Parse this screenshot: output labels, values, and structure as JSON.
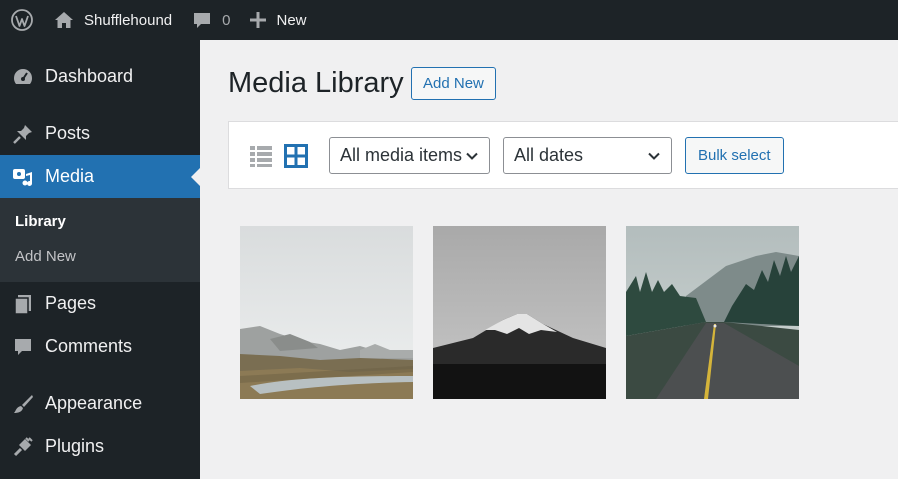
{
  "adminbar": {
    "site_name": "Shufflehound",
    "comments_count": "0",
    "new_label": "New"
  },
  "sidebar": {
    "items": [
      {
        "label": "Dashboard",
        "icon": "dashboard-icon"
      },
      {
        "label": "Posts",
        "icon": "pin-icon"
      },
      {
        "label": "Media",
        "icon": "media-icon"
      },
      {
        "label": "Pages",
        "icon": "pages-icon"
      },
      {
        "label": "Comments",
        "icon": "comment-icon"
      },
      {
        "label": "Appearance",
        "icon": "brush-icon"
      },
      {
        "label": "Plugins",
        "icon": "plug-icon"
      }
    ],
    "submenu": [
      {
        "label": "Library"
      },
      {
        "label": "Add New"
      }
    ]
  },
  "main": {
    "title": "Media Library",
    "add_new_label": "Add New",
    "filter_type": "All media items",
    "filter_date": "All dates",
    "bulk_select_label": "Bulk select",
    "thumbnails": [
      {
        "subject": "misty-hills-river",
        "icon": "image"
      },
      {
        "subject": "mountain-peak",
        "icon": "image"
      },
      {
        "subject": "forest-road",
        "icon": "image"
      }
    ]
  },
  "colors": {
    "admin_dark": "#1d2327",
    "accent_blue": "#2271b1",
    "submenu_bg": "#2c3338",
    "page_bg": "#f0f0f1"
  }
}
